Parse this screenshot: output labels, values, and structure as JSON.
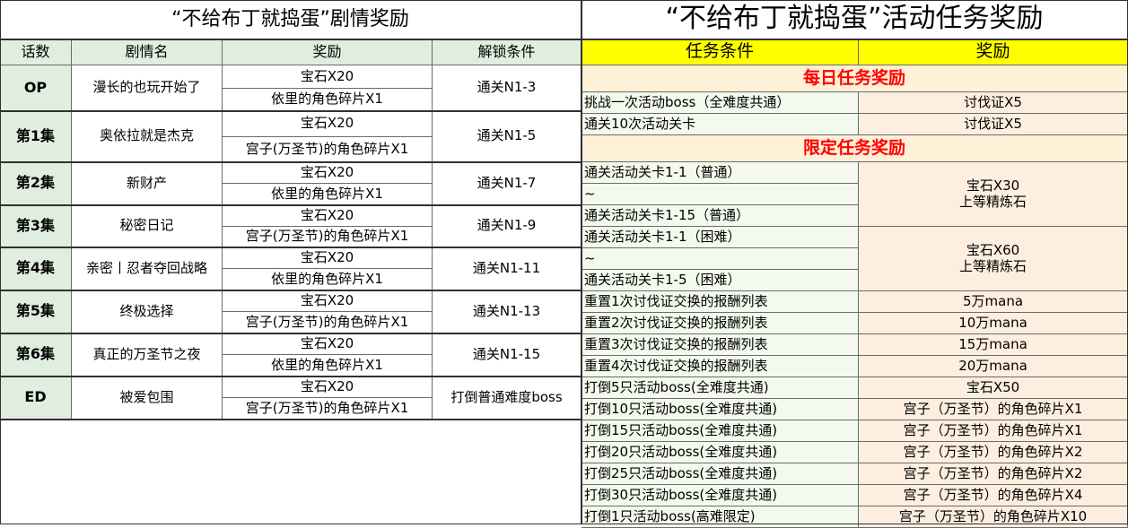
{
  "story": {
    "title": "“不给布丁就捣蛋”剧情奖励",
    "headers": [
      "话数",
      "剧情名",
      "奖励",
      "解锁条件"
    ],
    "episodes": [
      {
        "ep": "OP",
        "name": "漫长的也玩开始了",
        "reward1": "宝石X20",
        "reward2": "依里的角色碎片X1",
        "unlock": "通关N1-3"
      },
      {
        "ep": "第1集",
        "name": "奥依拉就是杰克",
        "reward1": "宝石X20",
        "reward2": "宫子(万圣节)的角色碎片X1",
        "unlock": "通关N1-5"
      },
      {
        "ep": "第2集",
        "name": "新财产",
        "reward1": "宝石X20",
        "reward2": "依里的角色碎片X1",
        "unlock": "通关N1-7"
      },
      {
        "ep": "第3集",
        "name": "秘密日记",
        "reward1": "宝石X20",
        "reward2": "宫子(万圣节)的角色碎片X1",
        "unlock": "通关N1-9"
      },
      {
        "ep": "第4集",
        "name": "亲密丨忍者夺回战略",
        "reward1": "宝石X20",
        "reward2": "依里的角色碎片X1",
        "unlock": "通关N1-11"
      },
      {
        "ep": "第5集",
        "name": "终极选择",
        "reward1": "宝石X20",
        "reward2": "宫子(万圣节)的角色碎片X1",
        "unlock": "通关N1-13"
      },
      {
        "ep": "第6集",
        "name": "真正的万圣节之夜",
        "reward1": "宝石X20",
        "reward2": "依里的角色碎片X1",
        "unlock": "通关N1-15"
      },
      {
        "ep": "ED",
        "name": "被爱包围",
        "reward1": "宝石X20",
        "reward2": "宫子(万圣节)的角色碎片X1",
        "unlock": "打倒普通难度boss"
      }
    ]
  },
  "event": {
    "title": "“不给布丁就捣蛋”活动任务奖励",
    "headers": [
      "任务条件",
      "奖励"
    ],
    "daily_label": "每日任务奖励",
    "daily": [
      {
        "task": "挑战一次活动boss（全难度共通）",
        "reward": "讨伐证X5"
      },
      {
        "task": "通关10次活动关卡",
        "reward": "讨伐证X5"
      }
    ],
    "limited_label": "限定任务奖励",
    "limited_groups": [
      {
        "tasks": [
          "通关活动关卡1-1（普通）",
          "~",
          "通关活动关卡1-15（普通）"
        ],
        "reward": [
          "宝石X30",
          "上等精炼石"
        ]
      },
      {
        "tasks": [
          "通关活动关卡1-1（困难）",
          "~",
          "通关活动关卡1-5（困难）"
        ],
        "reward": [
          "宝石X60",
          "上等精炼石"
        ]
      }
    ],
    "limited_rows": [
      {
        "task": "重置1次讨伐证交换的报酬列表",
        "reward": "5万mana"
      },
      {
        "task": "重置2次讨伐证交换的报酬列表",
        "reward": "10万mana"
      },
      {
        "task": "重置3次讨伐证交换的报酬列表",
        "reward": "15万mana"
      },
      {
        "task": "重置4次讨伐证交换的报酬列表",
        "reward": "20万mana"
      },
      {
        "task": "打倒5只活动boss(全难度共通)",
        "reward": "宝石X50"
      },
      {
        "task": "打倒10只活动boss(全难度共通)",
        "reward": "宫子（万圣节）的角色碎片X1"
      },
      {
        "task": "打倒15只活动boss(全难度共通)",
        "reward": "宫子（万圣节）的角色碎片X1"
      },
      {
        "task": "打倒20只活动boss(全难度共通)",
        "reward": "宫子（万圣节）的角色碎片X2"
      },
      {
        "task": "打倒25只活动boss(全难度共通)",
        "reward": "宫子（万圣节）的角色碎片X2"
      },
      {
        "task": "打倒30只活动boss(全难度共通)",
        "reward": "宫子（万圣节）的角色碎片X4"
      },
      {
        "task": "打倒1只活动boss(高难限定)",
        "reward": "宫子（万圣节）的角色碎片X10"
      }
    ]
  }
}
